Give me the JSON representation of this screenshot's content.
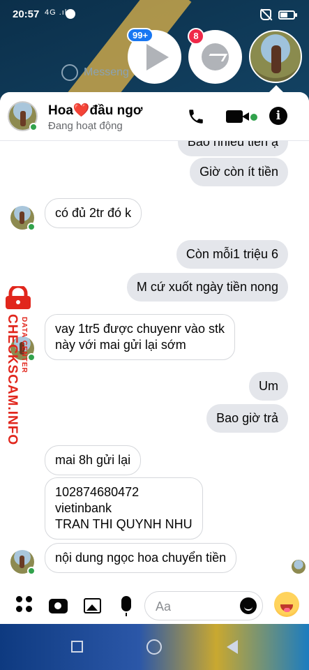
{
  "status_bar": {
    "time": "20:57",
    "network": "4G .ıl"
  },
  "background": {
    "app_label": "Messeng"
  },
  "chat_heads": {
    "video_badge": "99+",
    "messenger_badge": "8"
  },
  "header": {
    "name": "Hoa❤️đầu ngơ",
    "status": "Đang hoạt động"
  },
  "messages": {
    "m0": "Bao nhiêu tiền ạ",
    "m1": "Giờ còn ít tiền",
    "m2": "có đủ 2tr đó k",
    "m3": "Còn mỗi1 triệu 6",
    "m4": "M cứ xuốt ngày tiền nong",
    "m5_line1": "vay 1tr5 được chuyenr vào stk",
    "m5_line2": "này với mai gửi lại sớm",
    "m6": "Um",
    "m7": "Bao giờ trả",
    "m8": "mai 8h gửi lại",
    "m9_line1": "102874680472",
    "m9_line2": "vietinbank",
    "m9_line3": "TRAN THI QUYNH NHU",
    "m10": "nội dung ngọc hoa chuyển tiền"
  },
  "watermark": {
    "site": "CHECKSCAM.INFO",
    "sub": "DATA CENTER"
  },
  "composer": {
    "placeholder": "Aa"
  }
}
